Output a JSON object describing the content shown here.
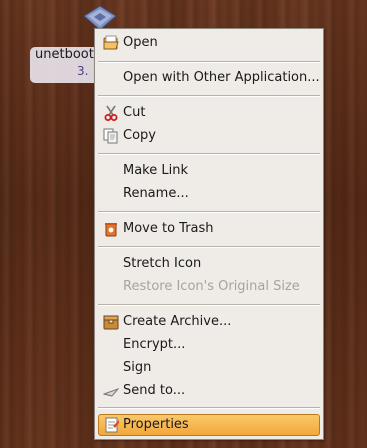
{
  "desktop": {
    "icon_name": "package-icon",
    "label_line1": "unetboot",
    "label_line2": "3."
  },
  "context_menu": {
    "items": [
      {
        "label": "Open",
        "icon": "folder-open-icon",
        "enabled": true
      },
      {
        "label": "Open with Other Application...",
        "icon": "",
        "enabled": true
      },
      {
        "label": "Cut",
        "icon": "scissors-icon",
        "enabled": true
      },
      {
        "label": "Copy",
        "icon": "copy-icon",
        "enabled": true
      },
      {
        "label": "Make Link",
        "icon": "",
        "enabled": true
      },
      {
        "label": "Rename...",
        "icon": "",
        "enabled": true
      },
      {
        "label": "Move to Trash",
        "icon": "trash-icon",
        "enabled": true
      },
      {
        "label": "Stretch Icon",
        "icon": "",
        "enabled": true
      },
      {
        "label": "Restore Icon's Original Size",
        "icon": "",
        "enabled": false
      },
      {
        "label": "Create Archive...",
        "icon": "archive-icon",
        "enabled": true
      },
      {
        "label": "Encrypt...",
        "icon": "",
        "enabled": true
      },
      {
        "label": "Sign",
        "icon": "",
        "enabled": true
      },
      {
        "label": "Send to...",
        "icon": "send-icon",
        "enabled": true
      },
      {
        "label": "Properties",
        "icon": "properties-icon",
        "enabled": true,
        "selected": true
      }
    ]
  },
  "colors": {
    "menu_bg": "#efebe7",
    "highlight": "#f3a73a",
    "disabled_text": "#a9a39c"
  }
}
